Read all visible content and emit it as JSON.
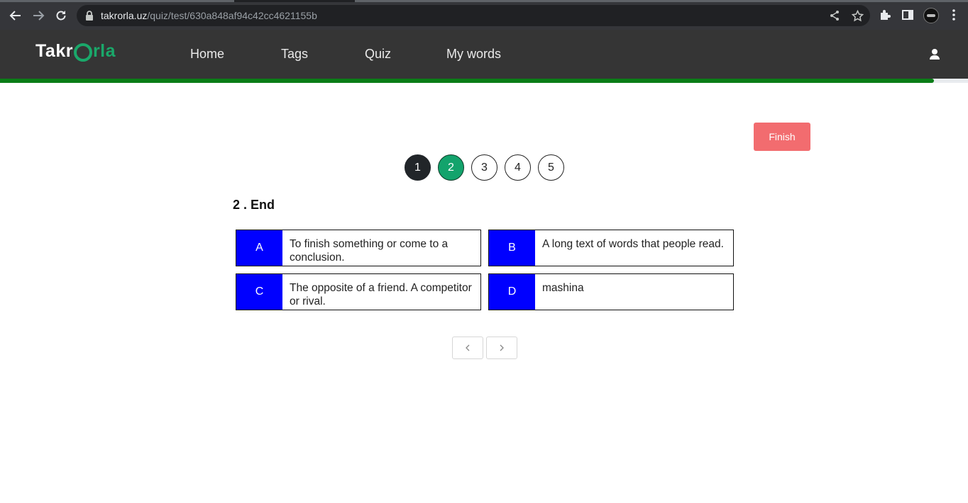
{
  "browser": {
    "url_host": "takrorla.uz",
    "url_path": "/quiz/test/630a848af94c42cc4621155b",
    "icons": [
      "back-icon",
      "forward-icon",
      "reload-icon",
      "lock-icon",
      "share-icon",
      "star-icon",
      "extensions-icon",
      "side-panel-icon",
      "profile-avatar",
      "menu-icon"
    ]
  },
  "navbar": {
    "logo_part1": "Takr",
    "logo_part2": "rla",
    "links": [
      "Home",
      "Tags",
      "Quiz",
      "My words"
    ],
    "user_icon": "user-icon"
  },
  "progress": {
    "value_percent": 96.5,
    "color": "#0b7d17"
  },
  "quiz": {
    "finish_label": "Finish",
    "question_numbers": [
      "1",
      "2",
      "3",
      "4",
      "5"
    ],
    "answered": [
      1
    ],
    "current": 2,
    "question": "2 . End",
    "options": [
      {
        "letter": "A",
        "text": "To finish something or come to a conclusion."
      },
      {
        "letter": "B",
        "text": "A long text of words that people read."
      },
      {
        "letter": "C",
        "text": "The opposite of a friend. A competitor or rival."
      },
      {
        "letter": "D",
        "text": "mashina"
      }
    ],
    "prev_icon": "chevron-left-icon",
    "next_icon": "chevron-right-icon"
  },
  "colors": {
    "finish": "#f26c6f",
    "active_question": "#13a36c",
    "option_letter_bg": "#0000ff",
    "logo_green": "#1aa86a"
  }
}
